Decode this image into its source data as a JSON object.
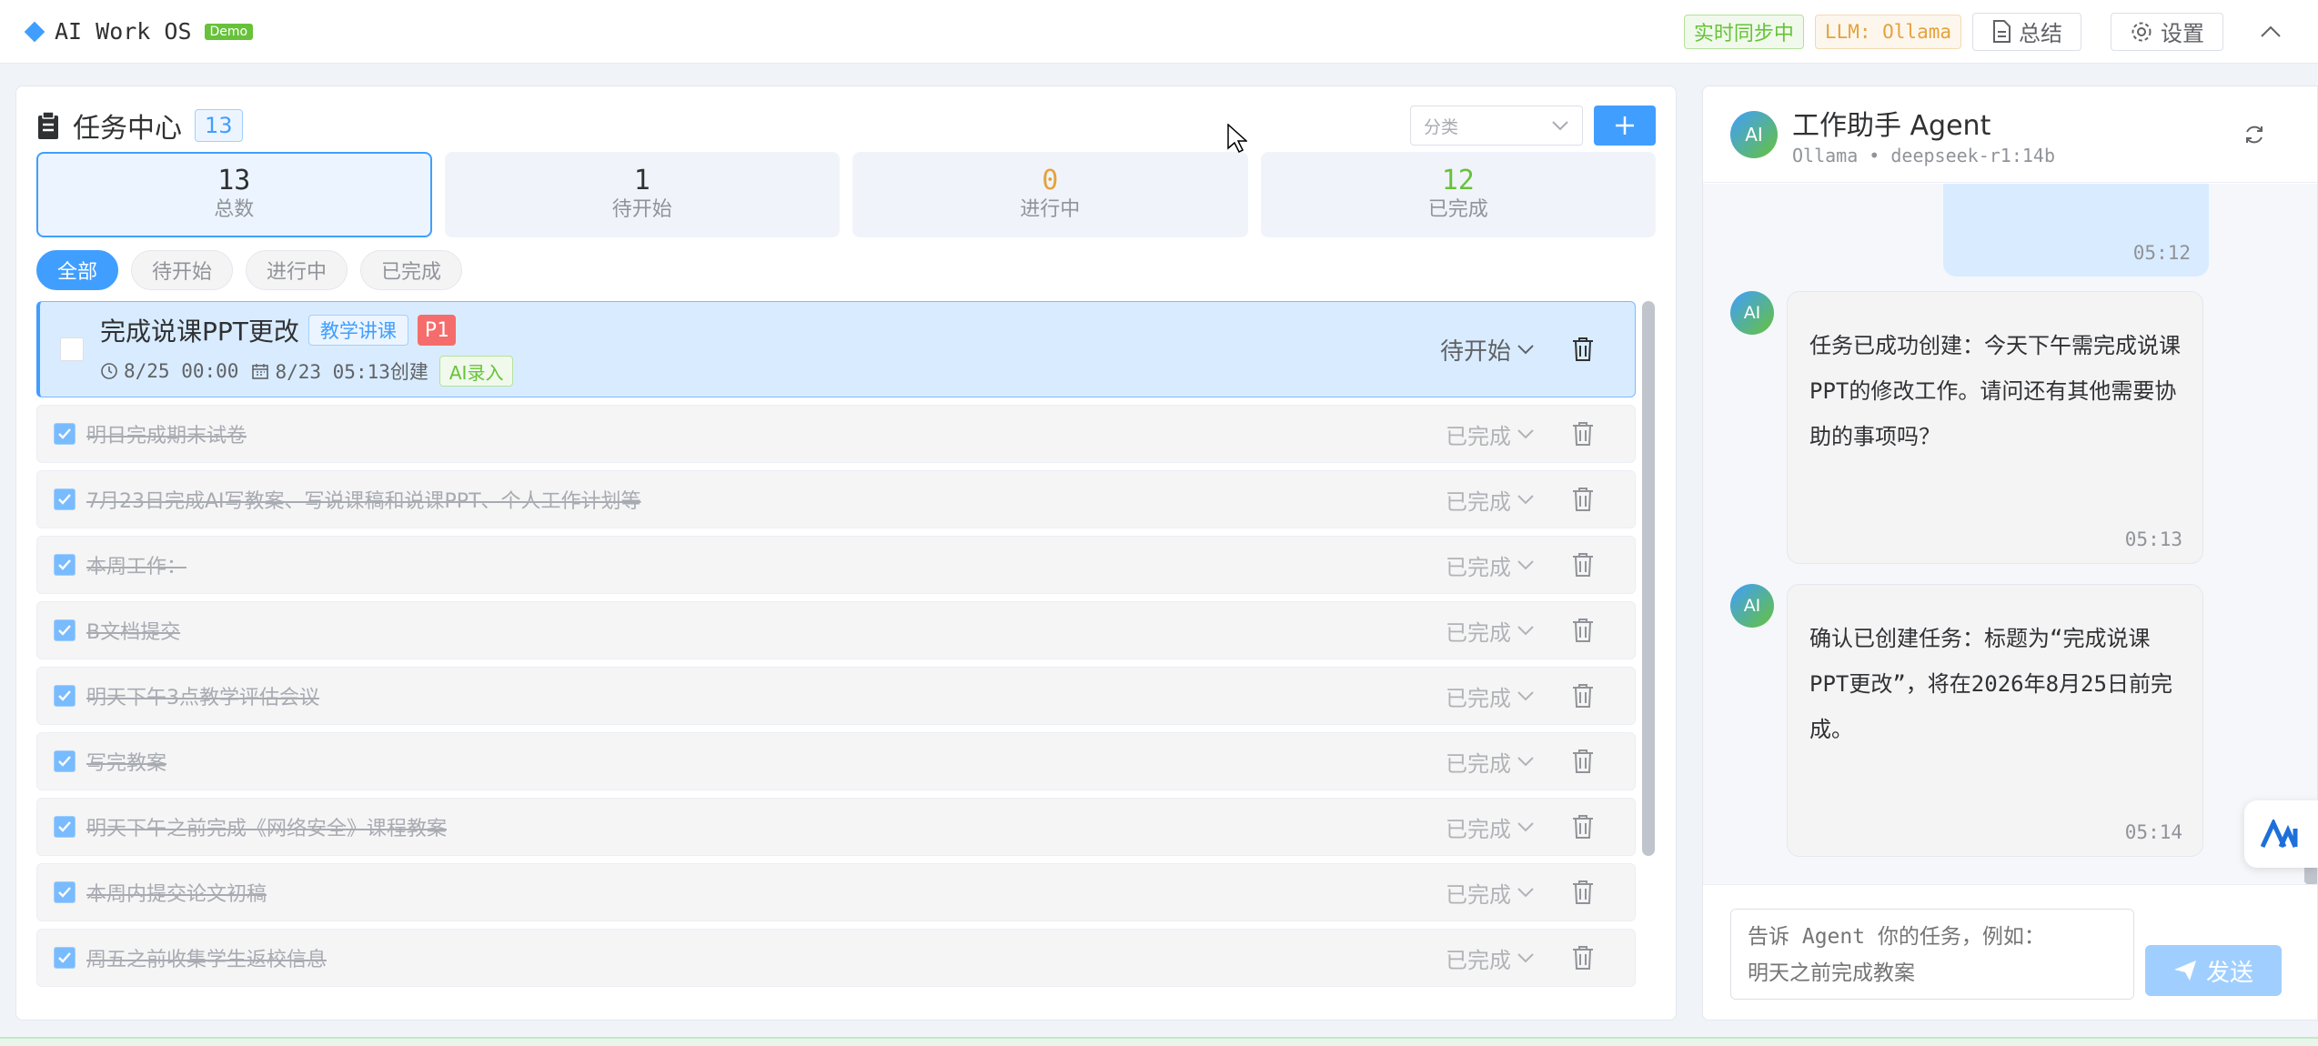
{
  "header": {
    "app_title": "AI Work OS",
    "demo_badge": "Demo",
    "sync_status": "实时同步中",
    "llm_label": "LLM: Ollama",
    "summary_label": "总结",
    "settings_label": "设置"
  },
  "tasks_panel": {
    "title": "任务中心",
    "count": "13",
    "category_placeholder": "分类",
    "stats": [
      {
        "value": "13",
        "label": "总数",
        "color": "#303133"
      },
      {
        "value": "1",
        "label": "待开始",
        "color": "#303133"
      },
      {
        "value": "0",
        "label": "进行中",
        "color": "#e6a23c"
      },
      {
        "value": "12",
        "label": "已完成",
        "color": "#67c23a"
      }
    ],
    "filters": [
      "全部",
      "待开始",
      "进行中",
      "已完成"
    ],
    "highlight_task": {
      "title": "完成说课PPT更改",
      "category": "教学讲课",
      "priority": "P1",
      "due": "8/25 00:00",
      "created": "8/23 05:13创建",
      "source_tag": "AI录入",
      "status": "待开始"
    },
    "done_tasks": [
      {
        "title": "明日完成期末试卷",
        "status": "已完成"
      },
      {
        "title": "7月23日完成AI写教案、写说课稿和说课PPT、个人工作计划等",
        "status": "已完成"
      },
      {
        "title": "本周工作：",
        "status": "已完成"
      },
      {
        "title": "B文档提交",
        "status": "已完成"
      },
      {
        "title": "明天下午3点教学评估会议",
        "status": "已完成"
      },
      {
        "title": "写完教案",
        "status": "已完成"
      },
      {
        "title": "明天下午之前完成《网络安全》课程教案",
        "status": "已完成"
      },
      {
        "title": "本周内提交论文初稿",
        "status": "已完成"
      },
      {
        "title": "周五之前收集学生返校信息",
        "status": "已完成"
      }
    ]
  },
  "chat": {
    "agent_name": "工作助手 Agent",
    "model": "Ollama • deepseek-r1:14b",
    "avatar_label": "AI",
    "user_msg_time": "05:12",
    "messages": [
      {
        "text": "任务已成功创建：今天下午需完成说课PPT的修改工作。请问还有其他需要协助的事项吗？",
        "time": "05:13"
      },
      {
        "text": "确认已创建任务：标题为“完成说课PPT更改”，将在2026年8月25日前完成。",
        "time": "05:14"
      }
    ],
    "input_placeholder": "告诉 Agent 你的任务，例如：\n明天之前完成教案",
    "send_label": "发送"
  }
}
